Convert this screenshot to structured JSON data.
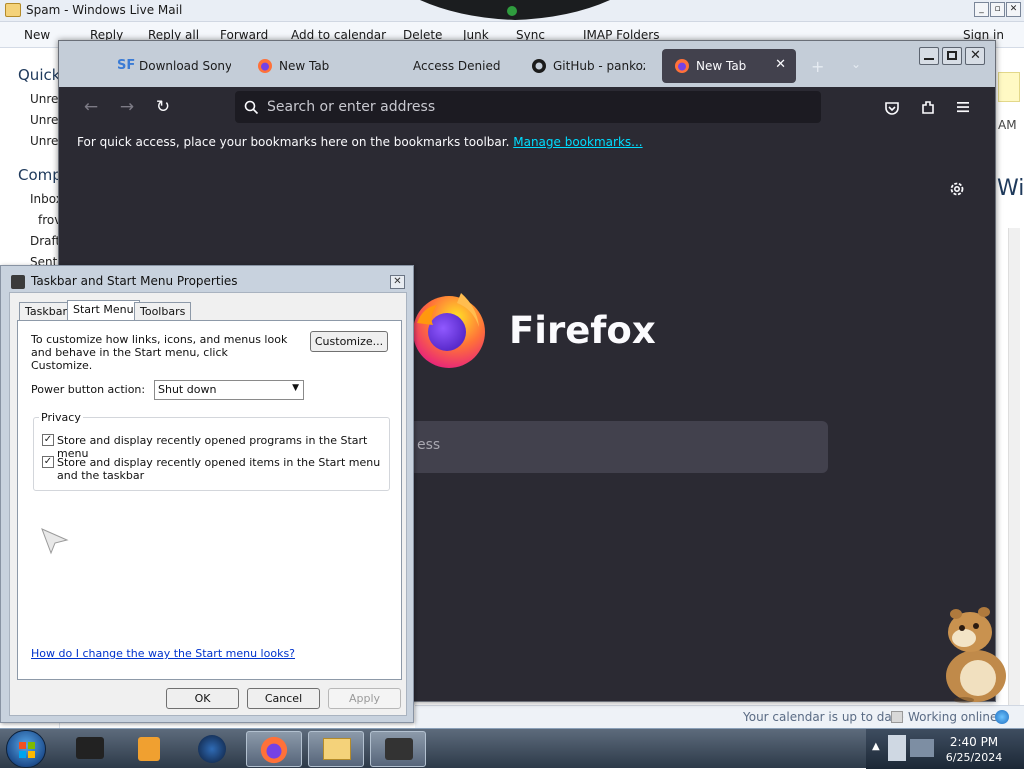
{
  "mail": {
    "title": "Spam - Windows Live Mail",
    "toolbar": [
      "New",
      "Reply",
      "Reply all",
      "Forward",
      "Add to calendar",
      "Delete",
      "Junk",
      "Sync",
      "IMAP Folders"
    ],
    "signin": "Sign in",
    "left_sections": [
      "Quick",
      "Comp"
    ],
    "left_items": [
      "Unre",
      "Unre",
      "Unre",
      "Inbox",
      "frov",
      "Draft",
      "Sent"
    ],
    "right_partial": [
      "AM",
      "Wi"
    ],
    "status_calendar": "Your calendar is up to date",
    "status_online": "Working online"
  },
  "firefox": {
    "tabs": [
      {
        "label": "Download Sony V",
        "icon": "sourceforge-icon"
      },
      {
        "label": "New Tab",
        "icon": "firefox-icon"
      },
      {
        "label": "Access Denied",
        "icon": ""
      },
      {
        "label": "GitHub - pankoza",
        "icon": "github-icon"
      },
      {
        "label": "New Tab",
        "icon": "firefox-icon",
        "active": true
      }
    ],
    "url_placeholder": "Search or enter address",
    "bookmarks_text": "For quick access, place your bookmarks here on the bookmarks toolbar.",
    "bookmarks_link": "Manage bookmarks...",
    "wordmark": "Firefox",
    "content_search_partial": "ess",
    "colors": {
      "bg": "#2b2a33",
      "tab_active": "#42414d",
      "link": "#00ddff"
    }
  },
  "dialog": {
    "title": "Taskbar and Start Menu Properties",
    "tabs": [
      "Taskbar",
      "Start Menu",
      "Toolbars"
    ],
    "active_tab": "Start Menu",
    "customize_text": "To customize how links, icons, and menus look and behave in the Start menu, click Customize.",
    "customize_button": "Customize...",
    "power_label": "Power button action:",
    "power_value": "Shut down",
    "privacy_label": "Privacy",
    "privacy_options": [
      {
        "label": "Store and display recently opened programs in the Start menu",
        "checked": true
      },
      {
        "label": "Store and display recently opened items in the Start menu and the taskbar",
        "checked": true
      }
    ],
    "help_link": "How do I change the way the Start menu looks?",
    "buttons": {
      "ok": "OK",
      "cancel": "Cancel",
      "apply": "Apply"
    }
  },
  "taskbar": {
    "time": "2:40 PM",
    "date": "6/25/2024"
  }
}
